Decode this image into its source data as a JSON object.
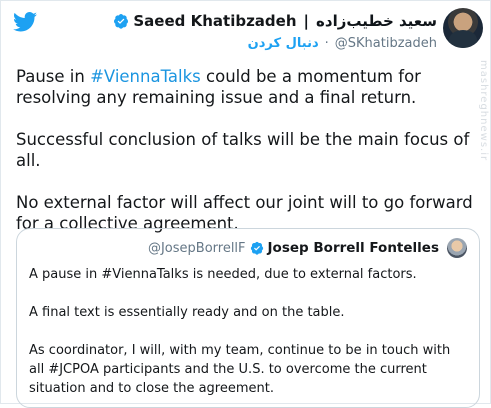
{
  "tweet": {
    "author": {
      "name": "Saeed Khatibzadeh",
      "separator": "|",
      "name_persian": "سعید خطیب‌زاده",
      "handle": "@SKhatibzadeh",
      "follow_label": "دنبال کردن",
      "dot": "·",
      "verified_icon": "verified-badge-icon",
      "avatar_icon": "avatar-photo"
    },
    "paragraphs": [
      {
        "before": "Pause in ",
        "hashtag": "#ViennaTalks",
        "after": " could be a momentum for resolving any remaining issue and a final return."
      },
      {
        "text": "Successful conclusion of talks will be the main focus of all."
      },
      {
        "text": "No external factor will affect our joint will to go forward for a collective agreement."
      }
    ],
    "watermark": "mashreghnews.ir"
  },
  "quoted": {
    "handle": "@JosepBorrellF",
    "name": "Josep Borrell Fontelles",
    "verified_icon": "verified-badge-icon",
    "paragraphs": [
      {
        "text": "A pause in #ViennaTalks is needed, due to external factors."
      },
      {
        "text": "A final text is essentially ready and on the table."
      },
      {
        "text": "As coordinator, I will, with my team, continue to be in touch with all #JCPOA participants and the U.S. to overcome the current situation and to close the agreement."
      }
    ]
  },
  "colors": {
    "accent": "#1da1f2",
    "text": "#14171a",
    "muted": "#657786",
    "border": "#ccd6dd"
  },
  "icons": {
    "logo": "twitter-bird-icon"
  }
}
